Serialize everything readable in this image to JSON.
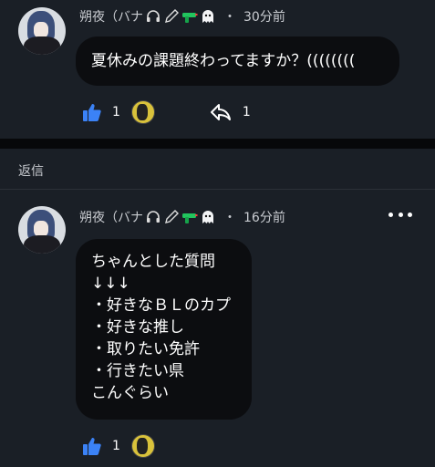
{
  "posts": [
    {
      "author": "朔夜（バナ",
      "time": "30分前",
      "body": [
        "夏休みの課題終わってますか？(((((((("
      ],
      "likes": "1",
      "shares": "1"
    },
    {
      "author": "朔夜（バナ",
      "time": "16分前",
      "body": [
        "ちゃんとした質問",
        "↓↓↓",
        "・好きなＢＬのカプ",
        "・好きな推し",
        "・取りたい免許",
        "・行きたい県",
        "こんぐらい"
      ],
      "likes": "1"
    }
  ],
  "section": {
    "reply_label": "返信"
  },
  "separator": "・",
  "colors": {
    "background": "#1a1f26",
    "bubble": "#0c0d10",
    "like_blue": "#3b82f6",
    "gun_green": "#22c55e"
  },
  "icons": [
    "headphones-icon",
    "pencil-icon",
    "water-gun-icon",
    "ghost-icon",
    "thumbs-up-icon",
    "reply-arrow-icon",
    "more-dots-icon"
  ]
}
